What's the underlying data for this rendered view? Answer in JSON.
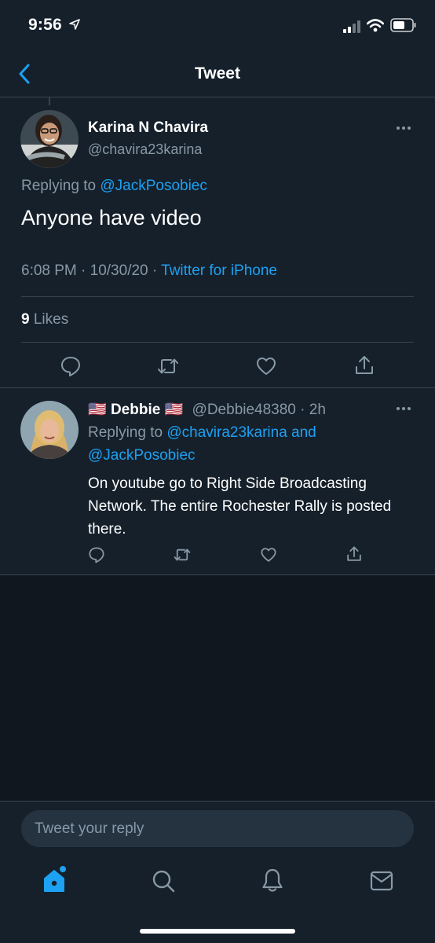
{
  "status_bar": {
    "time": "9:56"
  },
  "nav": {
    "title": "Tweet",
    "back_icon": "chevron-left-icon"
  },
  "main_tweet": {
    "name": "Karina N Chavira",
    "handle": "@chavira23karina",
    "replying_prefix": "Replying to",
    "replying_to": "@JackPosobiec",
    "text": "Anyone have video",
    "timestamp": "6:08 PM · 10/30/20 · ",
    "source": "Twitter for iPhone",
    "likes_count": "9",
    "likes_label": "Likes"
  },
  "reply_tweet": {
    "flag_left": "🇺🇸",
    "name": "Debbie",
    "flag_right": "🇺🇸",
    "handle_time": "@Debbie48380 · 2h",
    "replying_prefix": "Replying to",
    "replying_to_1": "@chavira23karina",
    "replying_and": "and",
    "replying_to_2": "@JackPosobiec",
    "text": "On youtube go to Right Side Broadcasting Network. The entire Rochester Rally is posted there."
  },
  "compose": {
    "placeholder": "Tweet your reply"
  },
  "colors": {
    "background": "#15202b",
    "accent": "#1da1f2",
    "muted": "#8899a6",
    "divider": "#38444d"
  }
}
